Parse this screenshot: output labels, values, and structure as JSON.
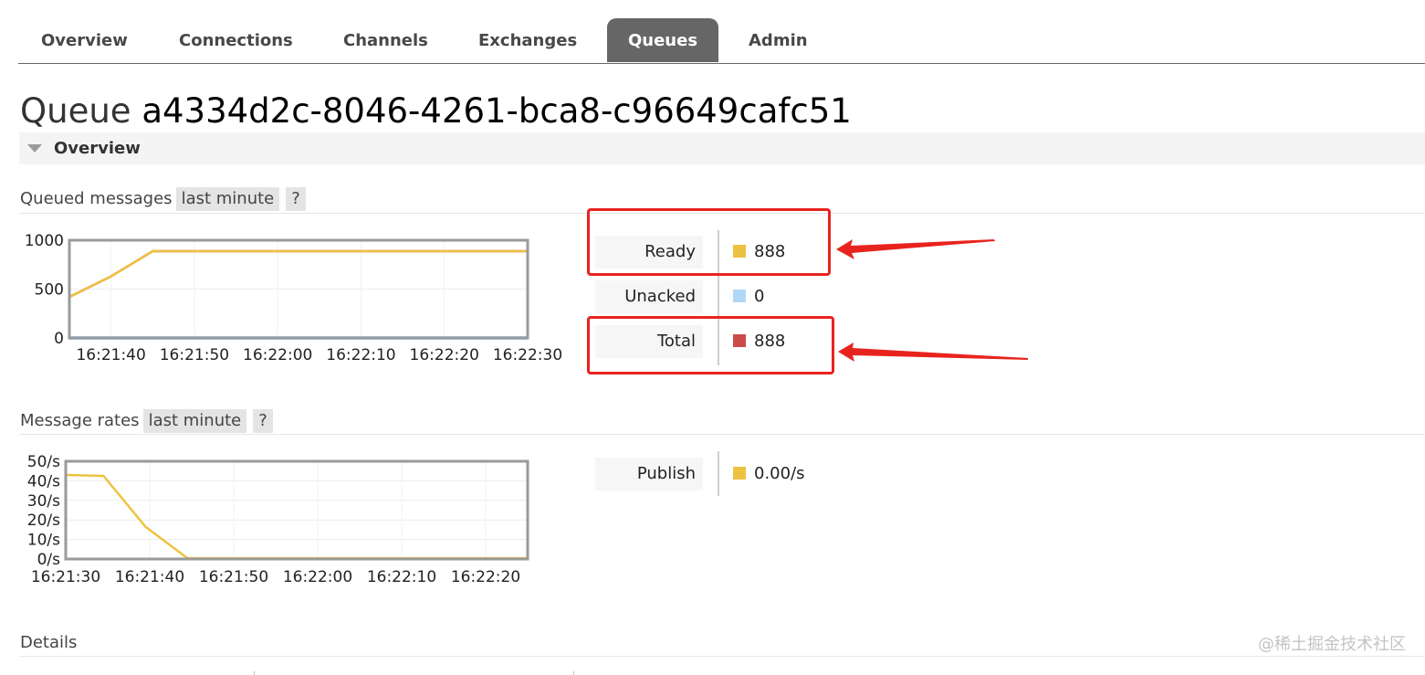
{
  "nav": {
    "tabs": [
      {
        "label": "Overview",
        "active": false
      },
      {
        "label": "Connections",
        "active": false
      },
      {
        "label": "Channels",
        "active": false
      },
      {
        "label": "Exchanges",
        "active": false
      },
      {
        "label": "Queues",
        "active": true
      },
      {
        "label": "Admin",
        "active": false
      }
    ]
  },
  "page": {
    "title_prefix": "Queue",
    "queue_name": "a4334d2c-8046-4261-bca8-c96649cafc51"
  },
  "overview_section": {
    "label": "Overview",
    "icon": "triangle-down-icon"
  },
  "queued_messages": {
    "heading": "Queued messages",
    "range_label": "last minute",
    "help_label": "?",
    "legend": [
      {
        "label": "Ready",
        "value": "888",
        "color": "#edc240"
      },
      {
        "label": "Unacked",
        "value": "0",
        "color": "#afd8f8"
      },
      {
        "label": "Total",
        "value": "888",
        "color": "#cb4b4b"
      }
    ]
  },
  "message_rates": {
    "heading": "Message rates",
    "range_label": "last minute",
    "help_label": "?",
    "legend": [
      {
        "label": "Publish",
        "value": "0.00/s",
        "color": "#edc240"
      }
    ]
  },
  "details": {
    "heading": "Details"
  },
  "annotations": {
    "highlight_color": "#e8231e",
    "highlighted_rows": [
      "Ready",
      "Total"
    ]
  },
  "watermark": "@稀土掘金技术社区",
  "chart_data": [
    {
      "type": "line",
      "ylim": [
        0,
        1000
      ],
      "yticks": [
        0,
        500,
        1000
      ],
      "ytick_labels": [
        "0",
        "500",
        "1000"
      ],
      "xlim": [
        0,
        55
      ],
      "xticks": [
        5,
        15,
        25,
        35,
        45,
        55
      ],
      "xtick_labels": [
        "16:21:40",
        "16:21:50",
        "16:22:00",
        "16:22:10",
        "16:22:20",
        "16:22:30"
      ],
      "grid": true,
      "series": [
        {
          "name": "Total",
          "color": "#cb4b4b",
          "points": [
            [
              0,
              420
            ],
            [
              5,
              630
            ],
            [
              10,
              888
            ],
            [
              55,
              888
            ]
          ]
        },
        {
          "name": "Unacked",
          "color": "#afd8f8",
          "points": [
            [
              0,
              0
            ],
            [
              55,
              0
            ]
          ]
        },
        {
          "name": "Ready",
          "color": "#edc240",
          "points": [
            [
              0,
              420
            ],
            [
              5,
              630
            ],
            [
              10,
              888
            ],
            [
              55,
              888
            ]
          ]
        }
      ]
    },
    {
      "type": "line",
      "ylim": [
        0,
        50
      ],
      "yticks": [
        0,
        10,
        20,
        30,
        40,
        50
      ],
      "ytick_labels": [
        "0/s",
        "10/s",
        "20/s",
        "30/s",
        "40/s",
        "50/s"
      ],
      "xlim": [
        0,
        55
      ],
      "xticks": [
        0,
        10,
        20,
        30,
        40,
        50
      ],
      "xtick_labels": [
        "16:21:30",
        "16:21:40",
        "16:21:50",
        "16:22:00",
        "16:22:10",
        "16:22:20"
      ],
      "grid": true,
      "series": [
        {
          "name": "Publish",
          "color": "#edc240",
          "points": [
            [
              0,
              43
            ],
            [
              4.5,
              42.5
            ],
            [
              9.5,
              16.5
            ],
            [
              14.5,
              0.4
            ],
            [
              55,
              0.4
            ]
          ]
        }
      ]
    }
  ]
}
